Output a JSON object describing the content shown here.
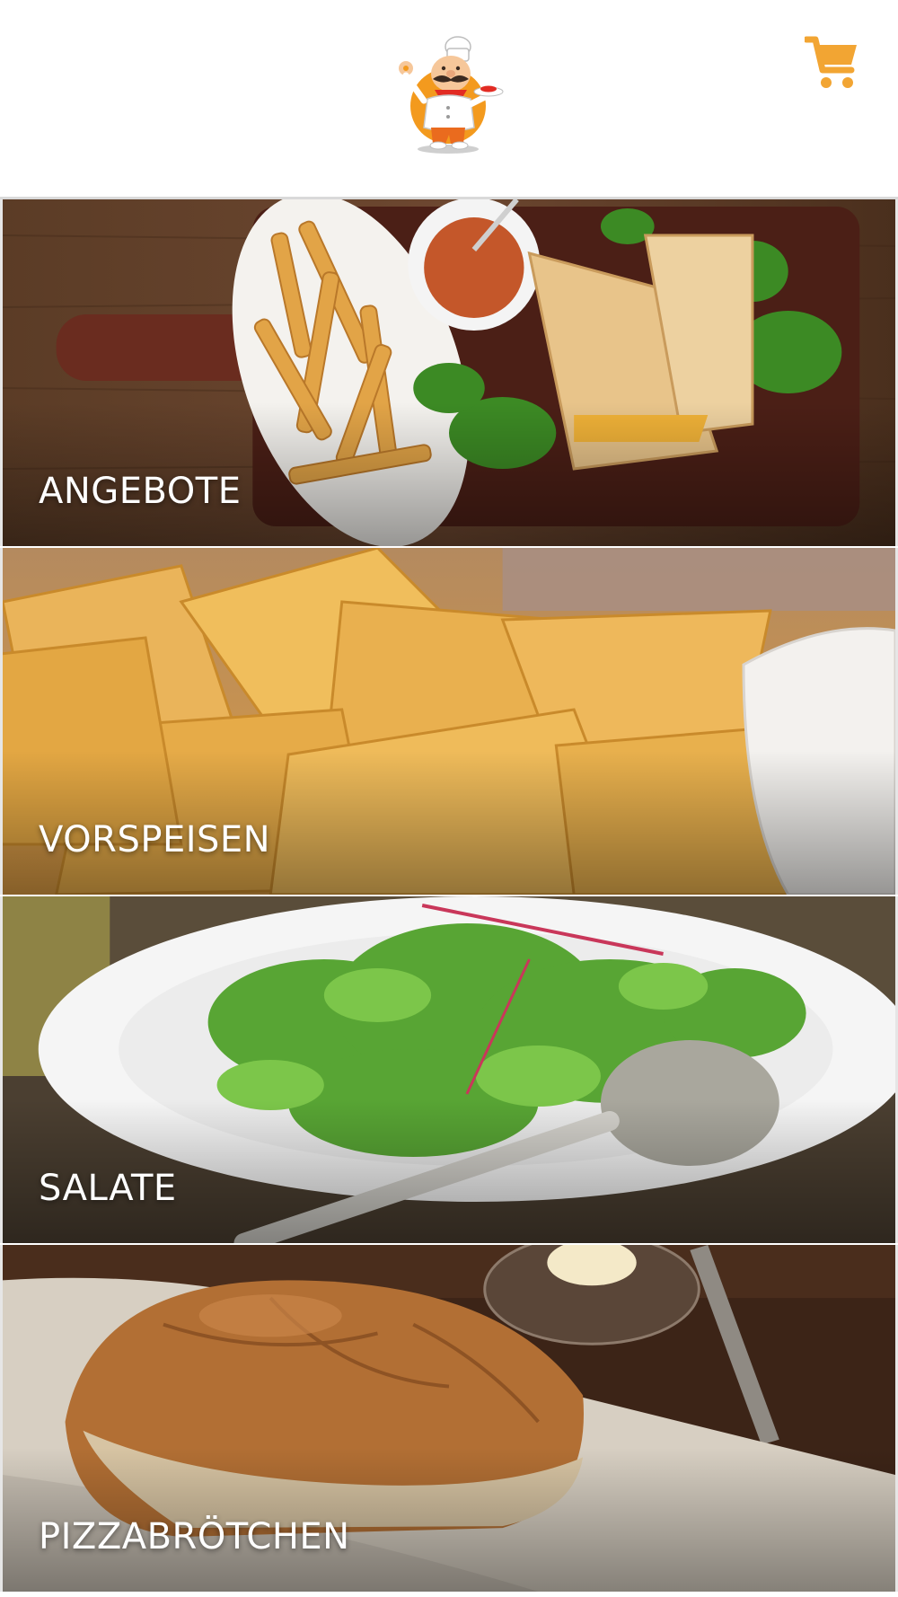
{
  "header": {
    "logo_icon": "chef-logo",
    "cart_icon": "shopping-cart-icon",
    "accent_color": "#f2a533"
  },
  "categories": [
    {
      "label": "ANGEBOTE",
      "image": "sandwich-fries-board"
    },
    {
      "label": "VORSPEISEN",
      "image": "tortilla-chips"
    },
    {
      "label": "SALATE",
      "image": "green-salad-plate"
    },
    {
      "label": "PIZZABRÖTCHEN",
      "image": "bread-loaf"
    }
  ]
}
